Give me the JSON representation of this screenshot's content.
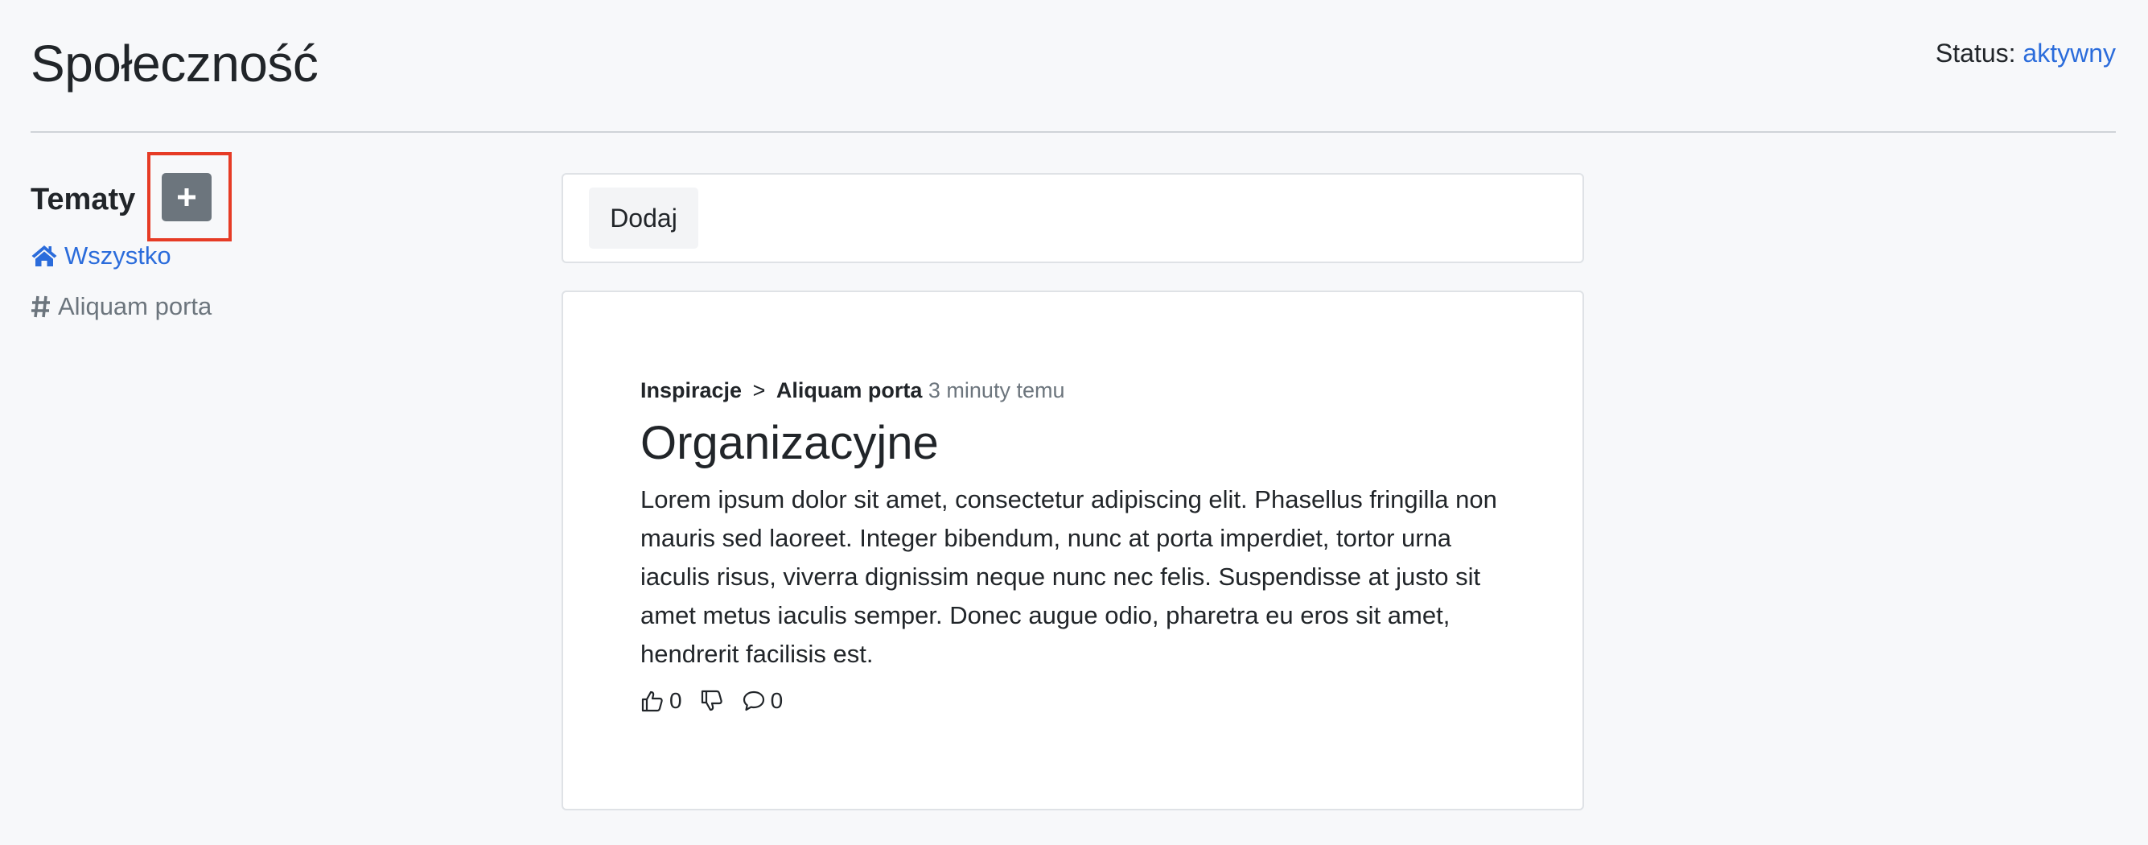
{
  "header": {
    "title": "Społeczność",
    "status_label": "Status:",
    "status_value": "aktywny"
  },
  "sidebar": {
    "title": "Tematy",
    "add_button_icon": "plus-icon",
    "items": [
      {
        "label": "Wszystko",
        "icon": "home-icon",
        "active": true
      },
      {
        "label": "Aliquam porta",
        "icon": "hash-icon",
        "active": false
      }
    ]
  },
  "main": {
    "add_label": "Dodaj",
    "post": {
      "breadcrumb_parent": "Inspiracje",
      "breadcrumb_separator": ">",
      "breadcrumb_child": "Aliquam porta",
      "time": "3 minuty temu",
      "title": "Organizacyjne",
      "body": "Lorem ipsum dolor sit amet, consectetur adipiscing elit. Phasellus fringilla non mauris sed laoreet. Integer bibendum, nunc at porta imperdiet, tortor urna iaculis risus, viverra dignissim neque nunc nec felis. Suspendisse at justo sit amet metus iaculis semper. Donec augue odio, pharetra eu eros sit amet, hendrerit facilisis est.",
      "likes": "0",
      "comments": "0"
    }
  },
  "colors": {
    "accent": "#2b6cdb",
    "secondary": "#6c757d",
    "highlight": "#e63b25",
    "background": "#f7f8fa"
  }
}
